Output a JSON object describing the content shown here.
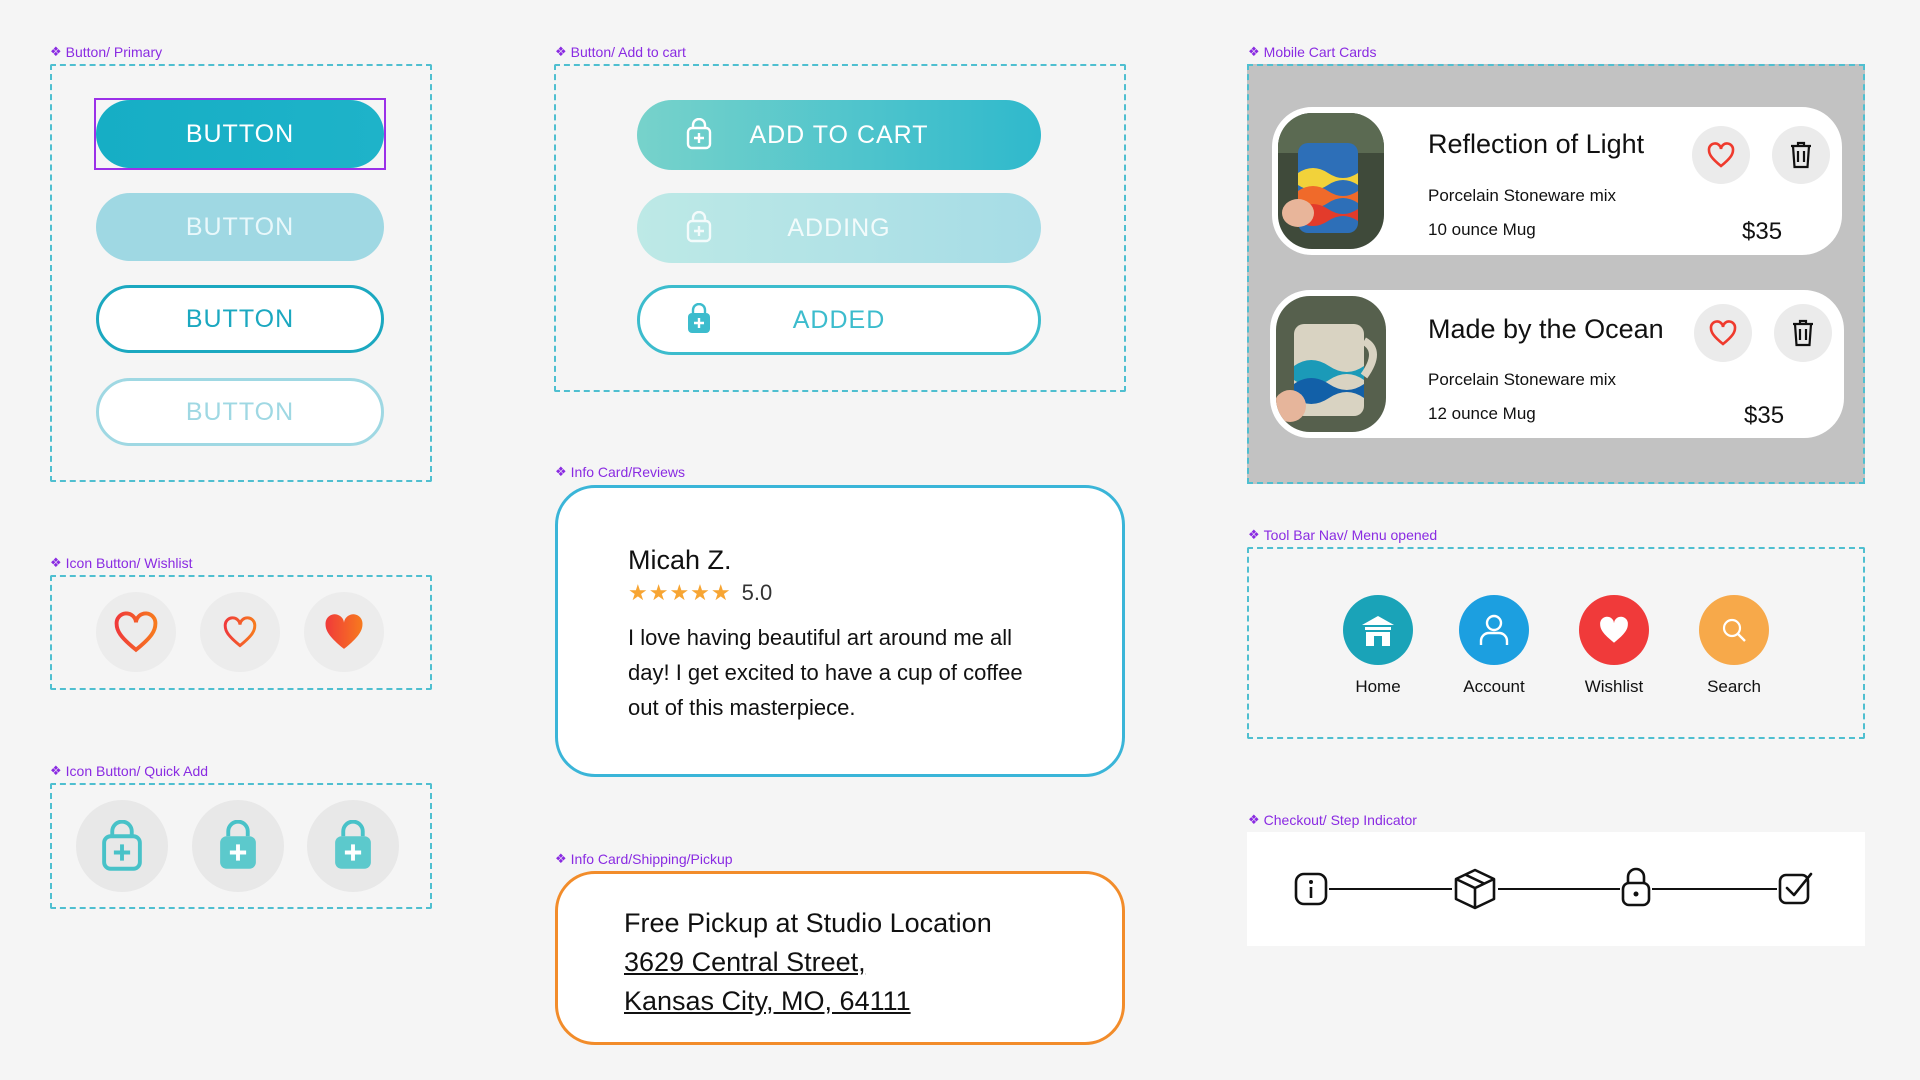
{
  "frames": {
    "primary": "Button/ Primary",
    "add_to_cart": "Button/ Add to cart",
    "mobile_cart": "Mobile Cart Cards",
    "wishlist": "Icon Button/ Wishlist",
    "quick_add": "Icon Button/ Quick Add",
    "reviews": "Info Card/Reviews",
    "toolbar": "Tool Bar Nav/ Menu opened",
    "shipping": "Info Card/Shipping/Pickup",
    "checkout": "Checkout/ Step Indicator"
  },
  "primary_buttons": [
    "BUTTON",
    "BUTTON",
    "BUTTON",
    "BUTTON"
  ],
  "cart_buttons": {
    "add": "ADD TO CART",
    "adding": "ADDING",
    "added": "ADDED"
  },
  "cart_cards": [
    {
      "title": "Reflection of Light",
      "material": "Porcelain Stoneware mix",
      "size": "10 ounce Mug",
      "price": "$35"
    },
    {
      "title": "Made by the Ocean",
      "material": "Porcelain Stoneware mix",
      "size": "12 ounce Mug",
      "price": "$35"
    }
  ],
  "review": {
    "name": "Micah Z.",
    "rating": "5.0",
    "stars": 5,
    "text_lines": [
      "I love having beautiful art around me all",
      "day! I get excited to have a cup of coffee",
      "out of this masterpiece."
    ]
  },
  "toolbar": {
    "items": [
      {
        "label": "Home",
        "icon": "home-icon",
        "color": "#1aa3b8"
      },
      {
        "label": "Account",
        "icon": "account-icon",
        "color": "#1c9fe0"
      },
      {
        "label": "Wishlist",
        "icon": "heart-icon",
        "color": "#f03a3a"
      },
      {
        "label": "Search",
        "icon": "search-icon",
        "color": "#f7a94a"
      }
    ]
  },
  "pickup": {
    "title": "Free Pickup at Studio Location",
    "address1": "3629 Central Street,",
    "address2": "Kansas City, MO, 64111"
  },
  "checkout_steps": [
    "info-icon",
    "box-icon",
    "lock-icon",
    "check-square-icon"
  ],
  "colors": {
    "accent": "#1ba8c0",
    "label_purple": "#8a2be2",
    "heart_red": "#f03a3a",
    "pickup_orange": "#f28c2a",
    "star_gold": "#f7a533"
  }
}
